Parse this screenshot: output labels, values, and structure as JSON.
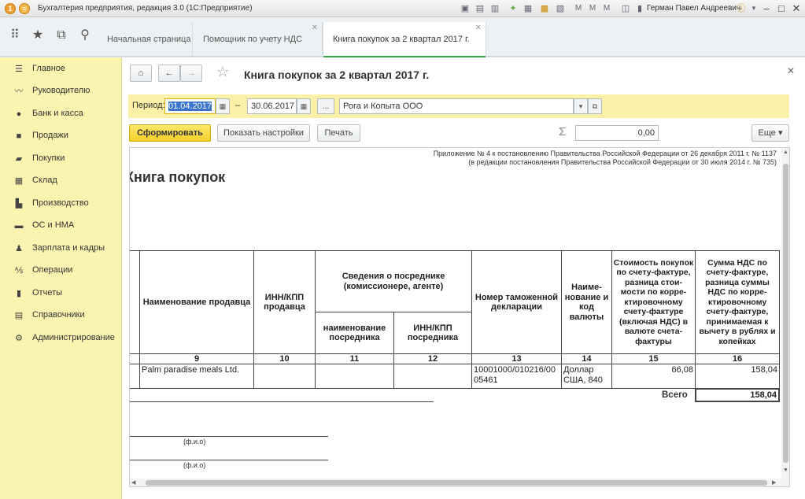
{
  "app": {
    "title": "Бухгалтерия предприятия, редакция 3.0  (1С:Предприятие)",
    "user": "Герман Павел Андреевич",
    "logo_letter": "1С"
  },
  "tabs": [
    {
      "label": "Начальная страница"
    },
    {
      "label": "Помощник по учету НДС"
    },
    {
      "label": "Книга покупок за 2 квартал 2017 г."
    }
  ],
  "sidebar": {
    "items": [
      {
        "label": "Главное",
        "icon": "menu-icon"
      },
      {
        "label": "Руководителю",
        "icon": "chart-icon"
      },
      {
        "label": "Банк и касса",
        "icon": "coin-icon"
      },
      {
        "label": "Продажи",
        "icon": "bag-icon"
      },
      {
        "label": "Покупки",
        "icon": "cart-icon"
      },
      {
        "label": "Склад",
        "icon": "warehouse-icon"
      },
      {
        "label": "Производство",
        "icon": "factory-icon"
      },
      {
        "label": "ОС и НМА",
        "icon": "truck-icon"
      },
      {
        "label": "Зарплата и кадры",
        "icon": "person-icon"
      },
      {
        "label": "Операции",
        "icon": "operations-icon"
      },
      {
        "label": "Отчеты",
        "icon": "report-icon"
      },
      {
        "label": "Справочники",
        "icon": "book-icon"
      },
      {
        "label": "Администрирование",
        "icon": "gear-icon"
      }
    ]
  },
  "form": {
    "title": "Книга покупок за 2 квартал 2017 г.",
    "period_label": "Период:",
    "date_from": "01.04.2017",
    "date_sep": "–",
    "date_to": "30.06.2017",
    "ellipsis": "...",
    "organization": "Рога и Копыта ООО",
    "generate_label": "Сформировать",
    "settings_label": "Показать настройки",
    "print_label": "Печать",
    "sum_symbol": "Σ",
    "sum_value": "0,00",
    "more_label": "Еще"
  },
  "report": {
    "appendix_line1": "Приложение № 4 к постановлению Правительства Российской Федерации от 26 декабря 2011 г. № 1137",
    "appendix_line2": "(в редакции постановления Правительства Российской Федерации от 30 июля 2014 г. № 735)",
    "heading": "Книга покупок",
    "headers": {
      "seller_name": "Наименование продавца",
      "seller_inn": "ИНН/КПП продавца",
      "intermediary": "Сведения о посреднике (комиссионере, агенте)",
      "intermediary_name": "наименование посредника",
      "intermediary_inn": "ИНН/КПП посредника",
      "customs_decl": "Номер таможенной декларации",
      "currency": "Наиме- нование и код валюты",
      "cost": "Стоимость покупок по счету-фактуре, разница стои- мости по корре- ктировочному счету-фактуре (включая НДС) в валюте счета-фактуры",
      "vat": "Сумма НДС по счету-фактуре, разница суммы НДС по корре- ктировочному счету-фактуре, принимаемая к вычету в рублях и копейках"
    },
    "column_numbers": [
      "9",
      "10",
      "11",
      "12",
      "13",
      "14",
      "15",
      "16"
    ],
    "row": {
      "seller_name": "Palm paradise meals Ltd.",
      "seller_inn": "",
      "intermediary_name": "",
      "intermediary_inn": "",
      "customs_decl": "10001000/010216/0005461",
      "currency": "Доллар США, 840",
      "cost": "66,08",
      "vat": "158,04"
    },
    "total_label": "Всего",
    "total_value": "158,04",
    "fio_label": "(ф.и.о)"
  }
}
